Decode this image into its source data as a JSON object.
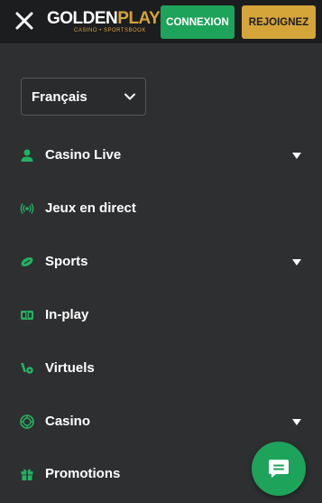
{
  "header": {
    "close_icon": "close-icon",
    "logo": {
      "main_left": "GOLDEN",
      "main_right": "PLAY",
      "tagline": "CASINO • SPORTSBOOK"
    },
    "connexion_label": "CONNEXION",
    "rejoignez_label": "REJOIGNEZ"
  },
  "language": {
    "selected": "Français",
    "icon": "chevron-down-icon"
  },
  "menu": {
    "items": [
      {
        "label": "Casino Live",
        "icon": "user-icon",
        "expandable": true
      },
      {
        "label": "Jeux en direct",
        "icon": "broadcast-icon",
        "expandable": false
      },
      {
        "label": "Sports",
        "icon": "ball-icon",
        "expandable": true
      },
      {
        "label": "In-play",
        "icon": "scoreboard-icon",
        "expandable": false
      },
      {
        "label": "Virtuels",
        "icon": "virtual-sport-icon",
        "expandable": false
      },
      {
        "label": "Casino",
        "icon": "chip-icon",
        "expandable": true
      },
      {
        "label": "Promotions",
        "icon": "gift-icon",
        "expandable": false
      }
    ]
  },
  "chat": {
    "icon": "chat-icon"
  },
  "colors": {
    "background": "#2e2f31",
    "topbar": "#1c1d1f",
    "accent_green": "#1ea35a",
    "accent_gold": "#d5a53a",
    "icon_green": "#22b35f"
  }
}
